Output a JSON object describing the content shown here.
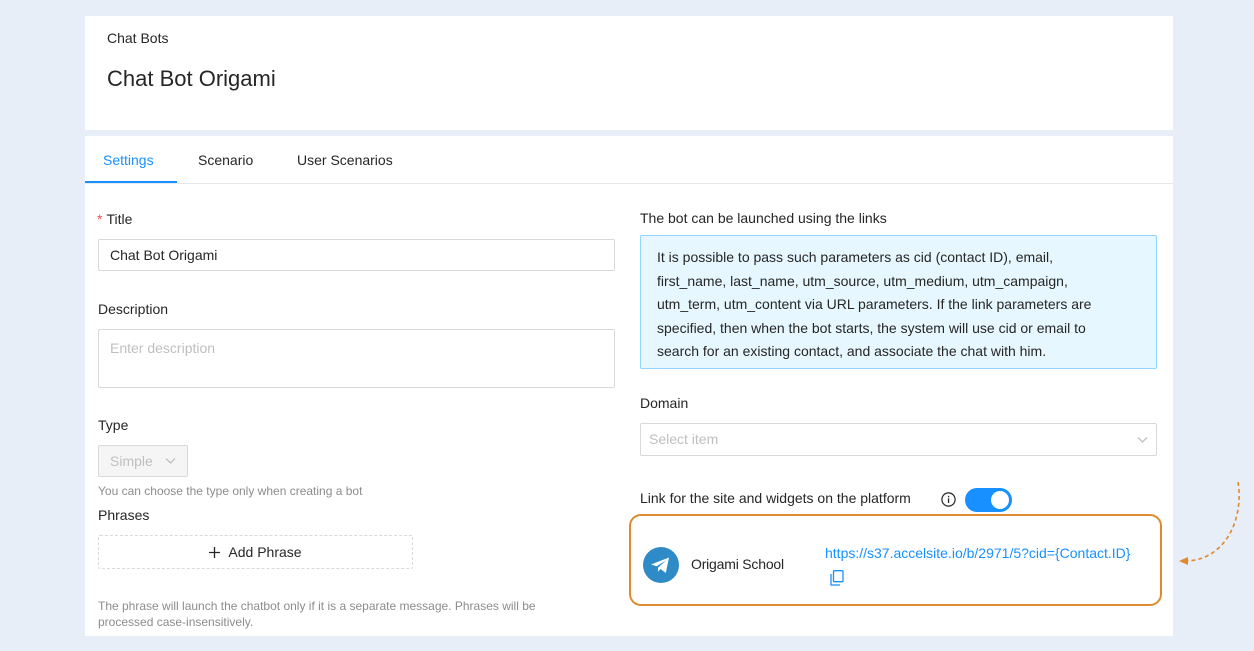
{
  "header": {
    "breadcrumb": "Chat Bots",
    "title": "Chat Bot Origami"
  },
  "tabs": [
    {
      "label": "Settings",
      "active": true
    },
    {
      "label": "Scenario",
      "active": false
    },
    {
      "label": "User Scenarios",
      "active": false
    }
  ],
  "form": {
    "title_label": "Title",
    "title_required_mark": "*",
    "title_value": "Chat Bot Origami",
    "description_label": "Description",
    "description_placeholder": "Enter description",
    "type_label": "Type",
    "type_value": "Simple",
    "type_hint": "You can choose the type only when creating a bot",
    "phrases_label": "Phrases",
    "add_phrase_label": "Add Phrase",
    "phrases_hint_line1": "The phrase will launch the chatbot only if it is a separate message. Phrases will be",
    "phrases_hint_line2": "processed case-insensitively."
  },
  "links": {
    "heading": "The bot can be launched using the links",
    "info_lines": [
      "It is possible to pass such parameters as cid (contact ID), email,",
      "first_name, last_name, utm_source, utm_medium, utm_campaign,",
      "utm_term, utm_content via URL parameters. If the link parameters are",
      "specified, then when the bot starts, the system will use cid or email to",
      "search for an existing contact, and associate the chat with him."
    ],
    "domain_label": "Domain",
    "domain_placeholder": "Select item",
    "platform_link_label": "Link for the site and widgets on the platform",
    "platform_link_enabled": true,
    "bot_name": "Origami School",
    "bot_url": "https://s37.accelsite.io/b/2971/5?cid={Contact.ID}"
  },
  "colors": {
    "accent": "#1890ff",
    "highlight": "#e08a2e",
    "info_bg": "#e6f7ff",
    "telegram": "#2f8ac8"
  },
  "icons": {
    "info": "info-icon",
    "copy": "copy-icon",
    "telegram": "telegram-icon",
    "chevron": "chevron-down-icon",
    "plus": "plus-icon",
    "arrow": "dashed-arrow-icon"
  }
}
